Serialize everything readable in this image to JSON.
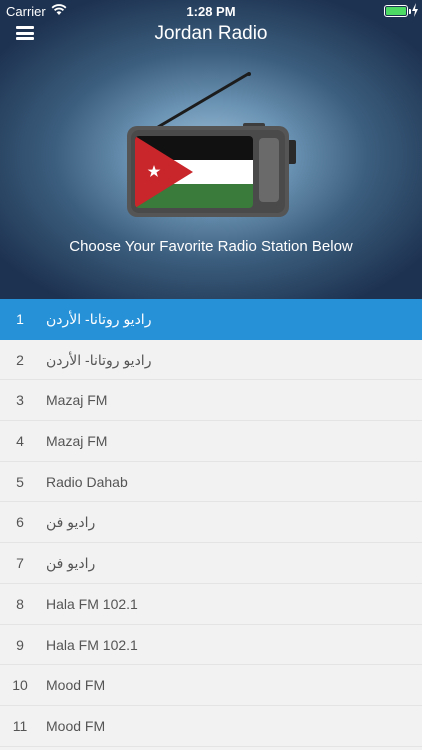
{
  "status_bar": {
    "carrier": "Carrier",
    "time": "1:28 PM"
  },
  "header": {
    "title": "Jordan Radio",
    "subtitle": "Choose Your Favorite Radio Station Below",
    "icons": {
      "menu": "hamburger-menu-icon",
      "art": "jordan-flag-radio-icon"
    }
  },
  "stations": [
    {
      "num": "1",
      "name": "راديو روتانا- الأردن",
      "selected": true
    },
    {
      "num": "2",
      "name": "راديو روتانا- الأردن",
      "selected": false
    },
    {
      "num": "3",
      "name": "Mazaj FM",
      "selected": false
    },
    {
      "num": "4",
      "name": "Mazaj FM",
      "selected": false
    },
    {
      "num": "5",
      "name": "Radio Dahab",
      "selected": false
    },
    {
      "num": "6",
      "name": "راديو فن",
      "selected": false
    },
    {
      "num": "7",
      "name": "راديو فن",
      "selected": false
    },
    {
      "num": "8",
      "name": "Hala FM 102.1",
      "selected": false
    },
    {
      "num": "9",
      "name": "Hala FM 102.1",
      "selected": false
    },
    {
      "num": "10",
      "name": "Mood FM",
      "selected": false
    },
    {
      "num": "11",
      "name": "Mood FM",
      "selected": false
    }
  ],
  "colors": {
    "selected_row": "#2791d8",
    "row_bg": "#f2f2f2",
    "header_dark": "#1d3250"
  }
}
